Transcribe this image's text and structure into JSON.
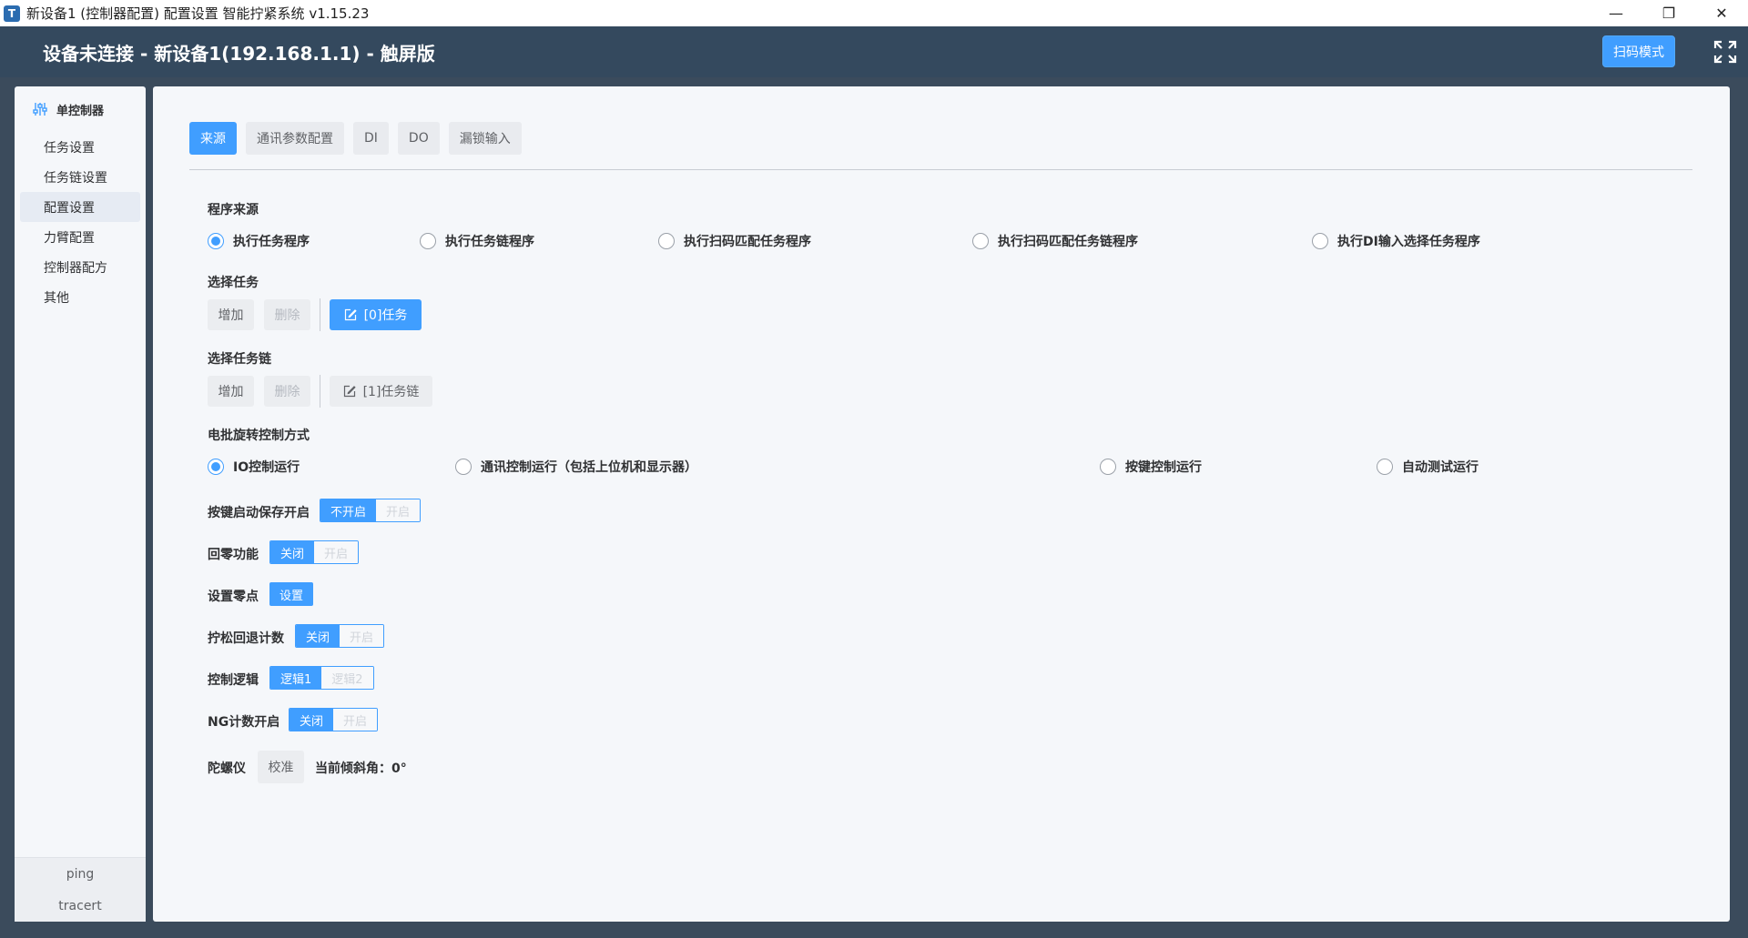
{
  "window": {
    "title": "新设备1 (控制器配置) 配置设置 智能拧紧系统 v1.15.23",
    "app_icon_glyph": "T",
    "minimize": "—",
    "restore": "❐",
    "close": "✕"
  },
  "header": {
    "title": "设备未连接 - 新设备1(192.168.1.1) - 触屏版",
    "scan_mode_label": "扫码模式"
  },
  "sidebar": {
    "section_title": "单控制器",
    "items": [
      {
        "label": "任务设置"
      },
      {
        "label": "任务链设置"
      },
      {
        "label": "配置设置"
      },
      {
        "label": "力臂配置"
      },
      {
        "label": "控制器配方"
      },
      {
        "label": "其他"
      }
    ],
    "active_index": 2,
    "footer": [
      "ping",
      "tracert"
    ]
  },
  "tabs": [
    {
      "label": "来源",
      "active": true
    },
    {
      "label": "通讯参数配置",
      "active": false
    },
    {
      "label": "DI",
      "active": false
    },
    {
      "label": "DO",
      "active": false
    },
    {
      "label": "漏锁输入",
      "active": false
    }
  ],
  "program_source": {
    "label": "程序来源",
    "options": [
      "执行任务程序",
      "执行任务链程序",
      "执行扫码匹配任务程序",
      "执行扫码匹配任务链程序",
      "执行DI输入选择任务程序"
    ],
    "selected_index": 0
  },
  "select_task": {
    "label": "选择任务",
    "add": "增加",
    "delete": "删除",
    "item": "[0]任务"
  },
  "select_task_chain": {
    "label": "选择任务链",
    "add": "增加",
    "delete": "删除",
    "item": "[1]任务链"
  },
  "rotation_control": {
    "label": "电批旋转控制方式",
    "options": [
      "IO控制运行",
      "通讯控制运行（包括上位机和显示器）",
      "按键控制运行",
      "自动测试运行"
    ],
    "selected_index": 0
  },
  "settings": {
    "key_start_keep": {
      "label": "按键启动保存开启",
      "on": "不开启",
      "off": "开启"
    },
    "return_zero": {
      "label": "回零功能",
      "on": "关闭",
      "off": "开启"
    },
    "set_zero": {
      "label": "设置零点",
      "button": "设置"
    },
    "loosen_count": {
      "label": "拧松回退计数",
      "on": "关闭",
      "off": "开启"
    },
    "control_logic": {
      "label": "控制逻辑",
      "on": "逻辑1",
      "off": "逻辑2"
    },
    "ng_count": {
      "label": "NG计数开启",
      "on": "关闭",
      "off": "开启"
    },
    "gyro": {
      "label": "陀螺仪",
      "button": "校准",
      "tilt_text": "当前倾斜角：0°"
    }
  },
  "colors": {
    "primary": "#409eff",
    "header_bg": "#34495e",
    "panel_bg": "#f5f7fa"
  }
}
